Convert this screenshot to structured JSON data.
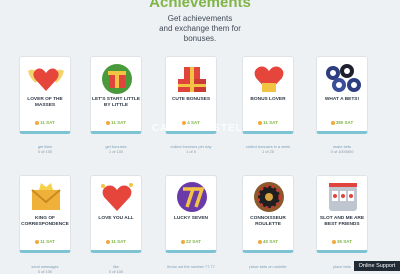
{
  "header": {
    "title": "Achievements",
    "subtitle_line1": "Get achievements",
    "subtitle_line2": "and exchange them for",
    "subtitle_line3": "bonuses."
  },
  "watermark": "CASINOCASTELLA.COM",
  "achievements": [
    {
      "name": "LOVER OF THE MASSES",
      "reward": "11 SAT",
      "task": "get likes",
      "progress": "0 of 100"
    },
    {
      "name": "LET'S START LITTLE BY LITTLE",
      "reward": "11 SAT",
      "task": "get bonuses",
      "progress": "1 of 100"
    },
    {
      "name": "CUTE BONUSES",
      "reward": "4 SAT",
      "task": "collect bonuses per day",
      "progress": "1 of 5"
    },
    {
      "name": "BONUS LOVER",
      "reward": "11 SAT",
      "task": "collect bonuses in a week",
      "progress": "1 of 25"
    },
    {
      "name": "WHAT A BETS!",
      "reward": "380 SAT",
      "task": "make bets",
      "progress": "0 of 1000000"
    },
    {
      "name": "KING OF CORRESPONDENCE",
      "reward": "11 SAT",
      "task": "send messages",
      "progress": "0 of 100"
    },
    {
      "name": "LOVE YOU ALL",
      "reward": "11 SAT",
      "task": "like",
      "progress": "0 of 100"
    },
    {
      "name": "LUCKY SEVEN",
      "reward": "22 SAT",
      "task": "throw out the number 77.77",
      "progress": ""
    },
    {
      "name": "CONNOISSEUR ROULETTE",
      "reward": "40 SAT",
      "task": "place bets on roulette",
      "progress": ""
    },
    {
      "name": "SLOT AND ME ARE BEST FRIENDS",
      "reward": "35 SAT",
      "task": "place bets",
      "progress": ""
    }
  ],
  "support_button": "Online Support"
}
